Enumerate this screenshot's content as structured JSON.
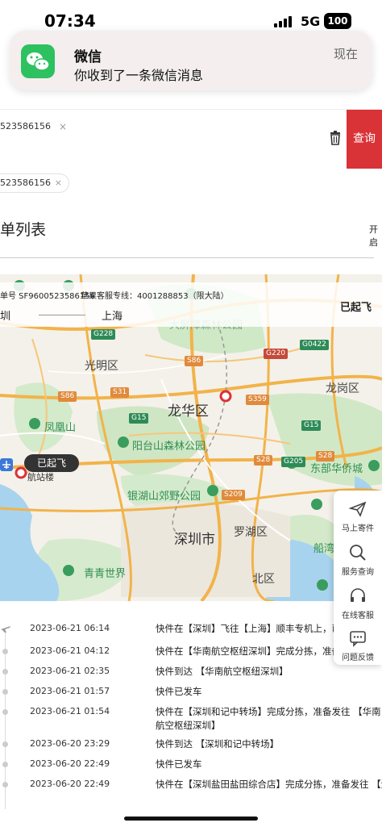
{
  "status_bar": {
    "time": "07:34",
    "network": "5G",
    "battery": "100"
  },
  "notification": {
    "app": "微信",
    "message": "你收到了一条微信消息",
    "time": "现在"
  },
  "search": {
    "tag": "523586156",
    "button": "查询"
  },
  "chip": {
    "value": "523586156"
  },
  "list": {
    "title": "单列表",
    "toggle_label": "开启"
  },
  "map_info": {
    "waybill": "单号 SF9600523586156",
    "hotline": "苹果客服专线：4001288853（限大陆）",
    "from": "圳",
    "to": "上海",
    "status": "已起飞"
  },
  "map": {
    "districts": [
      "光明区",
      "龙华区",
      "龙岗区",
      "深圳市",
      "罗湖区",
      "北区"
    ],
    "parks": [
      "大屏障森林公园",
      "凤凰山",
      "阳台山森林公园",
      "东部华侨城",
      "银湖山郊野公园",
      "青青世界",
      "船湾",
      "航站楼"
    ],
    "roads": [
      "G228",
      "S86",
      "S31",
      "G15",
      "S86",
      "S359",
      "G220",
      "G0422",
      "S28",
      "G205",
      "S209",
      "G15",
      "S28"
    ],
    "flight_badge": "已起飞"
  },
  "side_menu": [
    {
      "label": "马上寄件",
      "icon": "send-icon"
    },
    {
      "label": "服务查询",
      "icon": "search-icon"
    },
    {
      "label": "在线客服",
      "icon": "headset-icon"
    },
    {
      "label": "问题反馈",
      "icon": "chat-icon"
    }
  ],
  "timeline": [
    {
      "time": "2023-06-21 06:14",
      "desc": "快件在【深圳】飞往【上海】顺丰专机上，已"
    },
    {
      "time": "2023-06-21 04:12",
      "desc": "快件在【华南航空枢纽深圳】完成分拣，准备"
    },
    {
      "time": "2023-06-21 02:35",
      "desc": "快件到达 【华南航空枢纽深圳】"
    },
    {
      "time": "2023-06-21 01:57",
      "desc": "快件已发车"
    },
    {
      "time": "2023-06-21 01:54",
      "desc": "快件在【深圳和记中转场】完成分拣，准备发往 【华南航空枢纽深圳】"
    },
    {
      "time": "2023-06-20 23:29",
      "desc": "快件到达 【深圳和记中转场】"
    },
    {
      "time": "2023-06-20 22:49",
      "desc": "快件已发车"
    },
    {
      "time": "2023-06-20 22:49",
      "desc": "快件在【深圳盐田盐田综合店】完成分拣，准备发往 【深"
    }
  ]
}
